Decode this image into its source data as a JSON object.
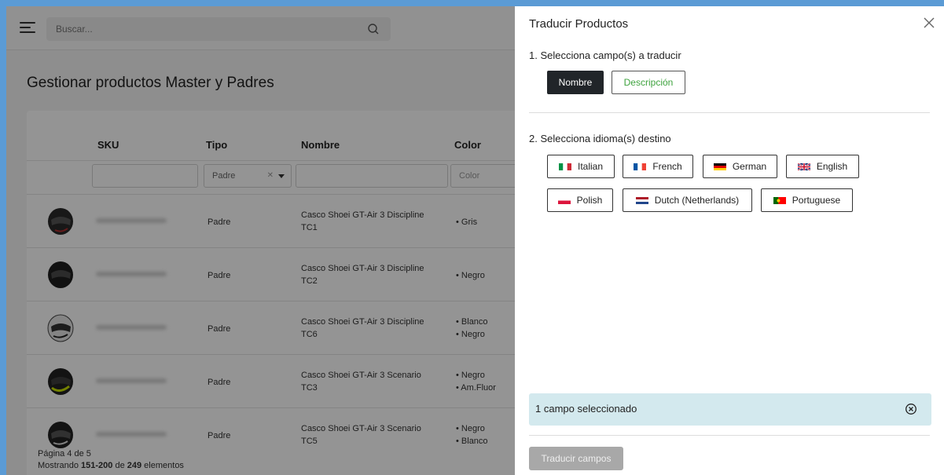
{
  "search": {
    "placeholder": "Buscar..."
  },
  "page": {
    "title": "Gestionar productos Master y Padres"
  },
  "table": {
    "headers": {
      "sku": "SKU",
      "tipo": "Tipo",
      "nombre": "Nombre",
      "color": "Color"
    },
    "filters": {
      "tipo_value": "Padre",
      "color_placeholder": "Color"
    },
    "rows": [
      {
        "tipo": "Padre",
        "nombre_1": "Casco Shoei GT-Air 3 Discipline",
        "nombre_2": "TC1",
        "color_1": "• Gris",
        "color_2": ""
      },
      {
        "tipo": "Padre",
        "nombre_1": "Casco Shoei GT-Air 3 Discipline",
        "nombre_2": "TC2",
        "color_1": "• Negro",
        "color_2": ""
      },
      {
        "tipo": "Padre",
        "nombre_1": "Casco Shoei GT-Air 3 Discipline",
        "nombre_2": "TC6",
        "color_1": "• Blanco",
        "color_2": "• Negro"
      },
      {
        "tipo": "Padre",
        "nombre_1": "Casco Shoei GT-Air 3 Scenario",
        "nombre_2": "TC3",
        "color_1": "• Negro",
        "color_2": "• Am.Fluor"
      },
      {
        "tipo": "Padre",
        "nombre_1": "Casco Shoei GT-Air 3 Scenario",
        "nombre_2": "TC5",
        "color_1": "• Negro",
        "color_2": "• Blanco"
      }
    ]
  },
  "pagination": {
    "page_text": "Página 4 de 5",
    "showing_prefix": "Mostrando ",
    "range": "151-200",
    "of": " de ",
    "total": "249",
    "suffix": " elementos"
  },
  "drawer": {
    "title": "Traducir Productos",
    "step1": "1. Selecciona campo(s) a traducir",
    "fields": [
      {
        "label": "Nombre",
        "selected": true
      },
      {
        "label": "Descripción",
        "selected": false
      }
    ],
    "step2": "2. Selecciona idioma(s) destino",
    "languages": [
      {
        "label": "Italian",
        "flag": "it"
      },
      {
        "label": "French",
        "flag": "fr"
      },
      {
        "label": "German",
        "flag": "de"
      },
      {
        "label": "English",
        "flag": "gb"
      },
      {
        "label": "Polish",
        "flag": "pl"
      },
      {
        "label": "Dutch (Netherlands)",
        "flag": "nl"
      },
      {
        "label": "Portuguese",
        "flag": "pt"
      }
    ],
    "alert_text": "1 campo seleccionado",
    "translate_button": "Traducir campos"
  },
  "colors": {
    "accent_dark": "#212529",
    "green_text": "#3fa33f",
    "alert_bg": "#d3e9ee",
    "disabled_button": "#a8a8a8"
  }
}
